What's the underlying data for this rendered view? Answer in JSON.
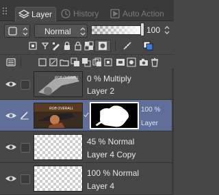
{
  "tabs": [
    {
      "label": "Layer",
      "icon": "layers-icon"
    },
    {
      "label": "History",
      "icon": "history-icon"
    },
    {
      "label": "Auto Action",
      "icon": "auto-action-icon"
    }
  ],
  "controls": {
    "blend_mode": "Normal",
    "opacity_value": "100",
    "opacity_percent": 100
  },
  "layers": [
    {
      "mode_line": "0 % Multiply",
      "name": "Layer 2",
      "visible": true,
      "selected": false
    },
    {
      "mode_line": "100 %",
      "mode_line2": "Layer",
      "name": "",
      "visible": true,
      "selected": true,
      "has_mask": true
    },
    {
      "mode_line": "45 % Normal",
      "name": "Layer 4 Copy",
      "visible": true,
      "selected": false
    },
    {
      "mode_line": "100 % Normal",
      "name": "Layer 4",
      "visible": true,
      "selected": false
    }
  ],
  "colors": {
    "panel_bg": "#474747",
    "selected_row": "#5f6f99",
    "accent_blue": "#3d7be0"
  }
}
